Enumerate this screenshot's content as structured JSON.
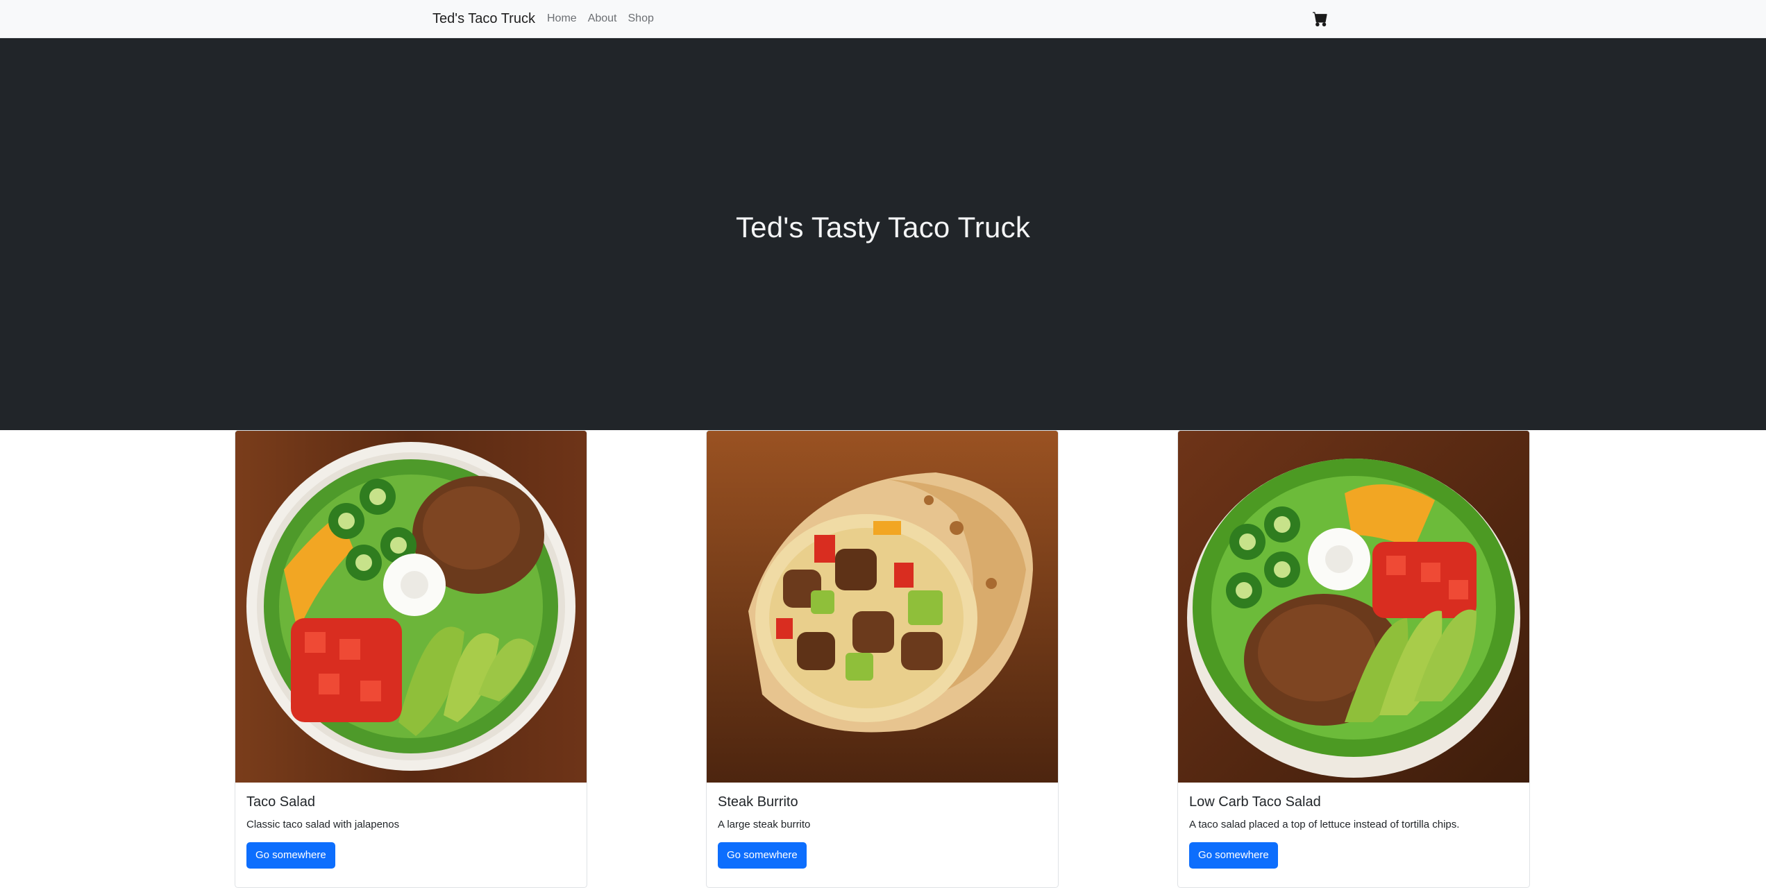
{
  "navbar": {
    "brand": "Ted's Taco Truck",
    "links": [
      {
        "label": "Home"
      },
      {
        "label": "About"
      },
      {
        "label": "Shop"
      }
    ],
    "cart_icon": "cart-icon"
  },
  "hero": {
    "title": "Ted's Tasty Taco Truck"
  },
  "cards": [
    {
      "title": "Taco Salad",
      "text": "Classic taco salad with jalapenos",
      "button": "Go somewhere",
      "image": "taco-salad-photo"
    },
    {
      "title": "Steak Burrito",
      "text": "A large steak burrito",
      "button": "Go somewhere",
      "image": "steak-burrito-photo"
    },
    {
      "title": "Low Carb Taco Salad",
      "text": "A taco salad placed a top of lettuce instead of tortilla chips.",
      "button": "Go somewhere",
      "image": "low-carb-taco-salad-photo"
    }
  ],
  "colors": {
    "navbar_bg": "#f8f9fa",
    "hero_bg": "#212529",
    "button_bg": "#0d6efd"
  }
}
